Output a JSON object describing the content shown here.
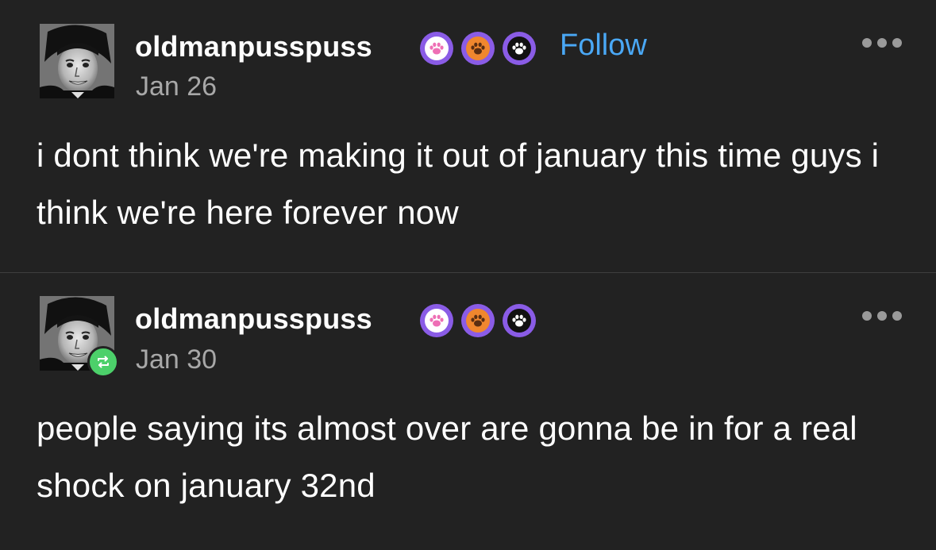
{
  "colors": {
    "background": "#222222",
    "text": "#ffffff",
    "muted": "#a8a8a8",
    "follow": "#4aa8f5",
    "reblog": "#4cd06a",
    "divider": "#3e3e3e"
  },
  "posts": [
    {
      "username": "oldmanpusspuss",
      "badges": [
        "pink-paw-badge-icon",
        "orange-paw-badge-icon",
        "black-paw-badge-icon"
      ],
      "follow_label": "Follow",
      "date": "Jan 26",
      "text": "i dont think we're making it out of january this time guys i think we're here forever now",
      "menu_icon": "more-options-icon"
    },
    {
      "username": "oldmanpusspuss",
      "badges": [
        "pink-paw-badge-icon",
        "orange-paw-badge-icon",
        "black-paw-badge-icon"
      ],
      "date": "Jan 30",
      "reblog_icon": "reblog-icon",
      "text": "people saying its almost over are gonna be in for a real shock on january 32nd",
      "menu_icon": "more-options-icon"
    }
  ]
}
